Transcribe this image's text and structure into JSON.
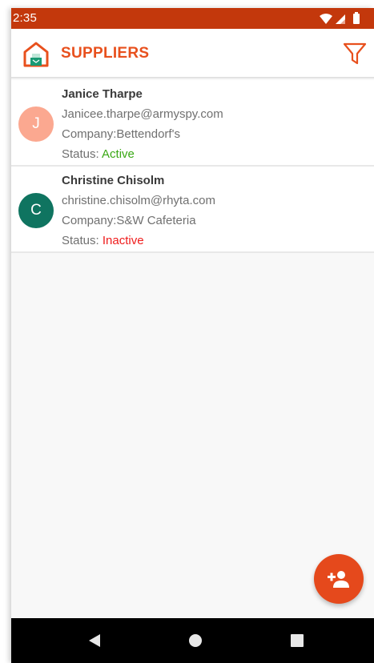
{
  "status_bar": {
    "time": "2:35"
  },
  "app_bar": {
    "title": "SUPPLIERS",
    "logo_icon": "warehouse-logo-icon",
    "filter_icon": "filter-icon"
  },
  "suppliers": [
    {
      "initial": "J",
      "name": "Janice Tharpe",
      "email": "Janicee.tharpe@armyspy.com",
      "company_label": "Company:",
      "company": "Bettendorf's",
      "status_label": "Status: ",
      "status": "Active",
      "avatar_color": "#fba890",
      "status_color": "#3aa815"
    },
    {
      "initial": "C",
      "name": "Christine Chisolm",
      "email": "christine.chisolm@rhyta.com",
      "company_label": "Company:",
      "company": "S&W Cafeteria",
      "status_label": "Status: ",
      "status": "Inactive",
      "avatar_color": "#0f7460",
      "status_color": "#ef1c1c"
    }
  ],
  "fab": {
    "icon": "add-person-icon"
  },
  "colors": {
    "status_bar": "#c3380c",
    "accent": "#e8501d",
    "fab": "#e5491c"
  }
}
